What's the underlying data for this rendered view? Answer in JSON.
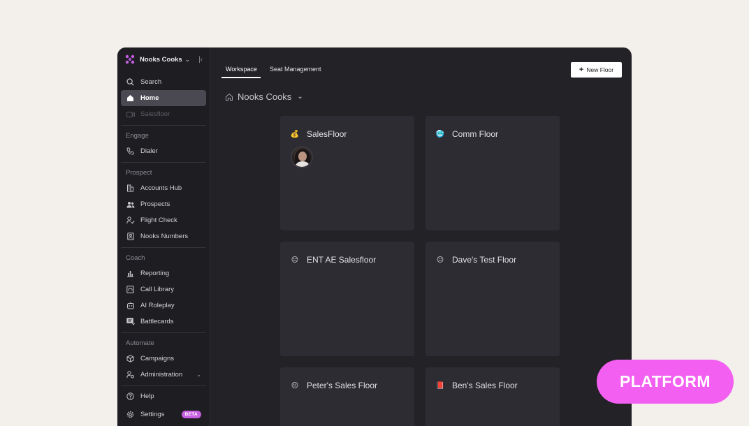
{
  "workspace": {
    "name": "Nooks Cooks"
  },
  "sidebar": {
    "top_items": [
      {
        "label": "Search"
      },
      {
        "label": "Home"
      },
      {
        "label": "Salesfloor"
      }
    ],
    "sections": {
      "engage": {
        "title": "Engage",
        "items": [
          {
            "label": "Dialer"
          }
        ]
      },
      "prospect": {
        "title": "Prospect",
        "items": [
          {
            "label": "Accounts Hub"
          },
          {
            "label": "Prospects"
          },
          {
            "label": "Flight Check"
          },
          {
            "label": "Nooks Numbers"
          }
        ]
      },
      "coach": {
        "title": "Coach",
        "items": [
          {
            "label": "Reporting"
          },
          {
            "label": "Call Library"
          },
          {
            "label": "AI Roleplay"
          },
          {
            "label": "Battlecards"
          }
        ]
      },
      "automate": {
        "title": "Automate",
        "items": [
          {
            "label": "Campaigns"
          },
          {
            "label": "Administration"
          }
        ]
      }
    },
    "bottom_items": [
      {
        "label": "Help"
      },
      {
        "label": "Settings",
        "badge": "BETA"
      }
    ]
  },
  "tabs": [
    {
      "label": "Workspace",
      "active": true
    },
    {
      "label": "Seat Management",
      "active": false
    }
  ],
  "new_floor_button": {
    "label": "New Floor"
  },
  "breadcrumb": {
    "label": "Nooks Cooks"
  },
  "floors": [
    {
      "name": "SalesFloor",
      "emoji": "💰",
      "has_avatar": true
    },
    {
      "name": "Comm Floor",
      "emoji": "🥶"
    },
    {
      "name": "ENT AE Salesfloor",
      "emoji": "😑"
    },
    {
      "name": "Dave's Test Floor",
      "emoji": "😐"
    },
    {
      "name": "Peter's Sales Floor",
      "emoji": "😐"
    },
    {
      "name": "Ben's Sales Floor",
      "emoji": "📕"
    }
  ],
  "overlay_badge": {
    "label": "PLATFORM"
  },
  "colors": {
    "page_bg": "#f3efea",
    "app_bg": "#232227",
    "sidebar_bg": "#1e1d22",
    "card_bg": "#2d2c32",
    "active_nav": "#4a4952",
    "beta_badge": "#c65fe0",
    "platform_pill": "#f35ff0"
  }
}
